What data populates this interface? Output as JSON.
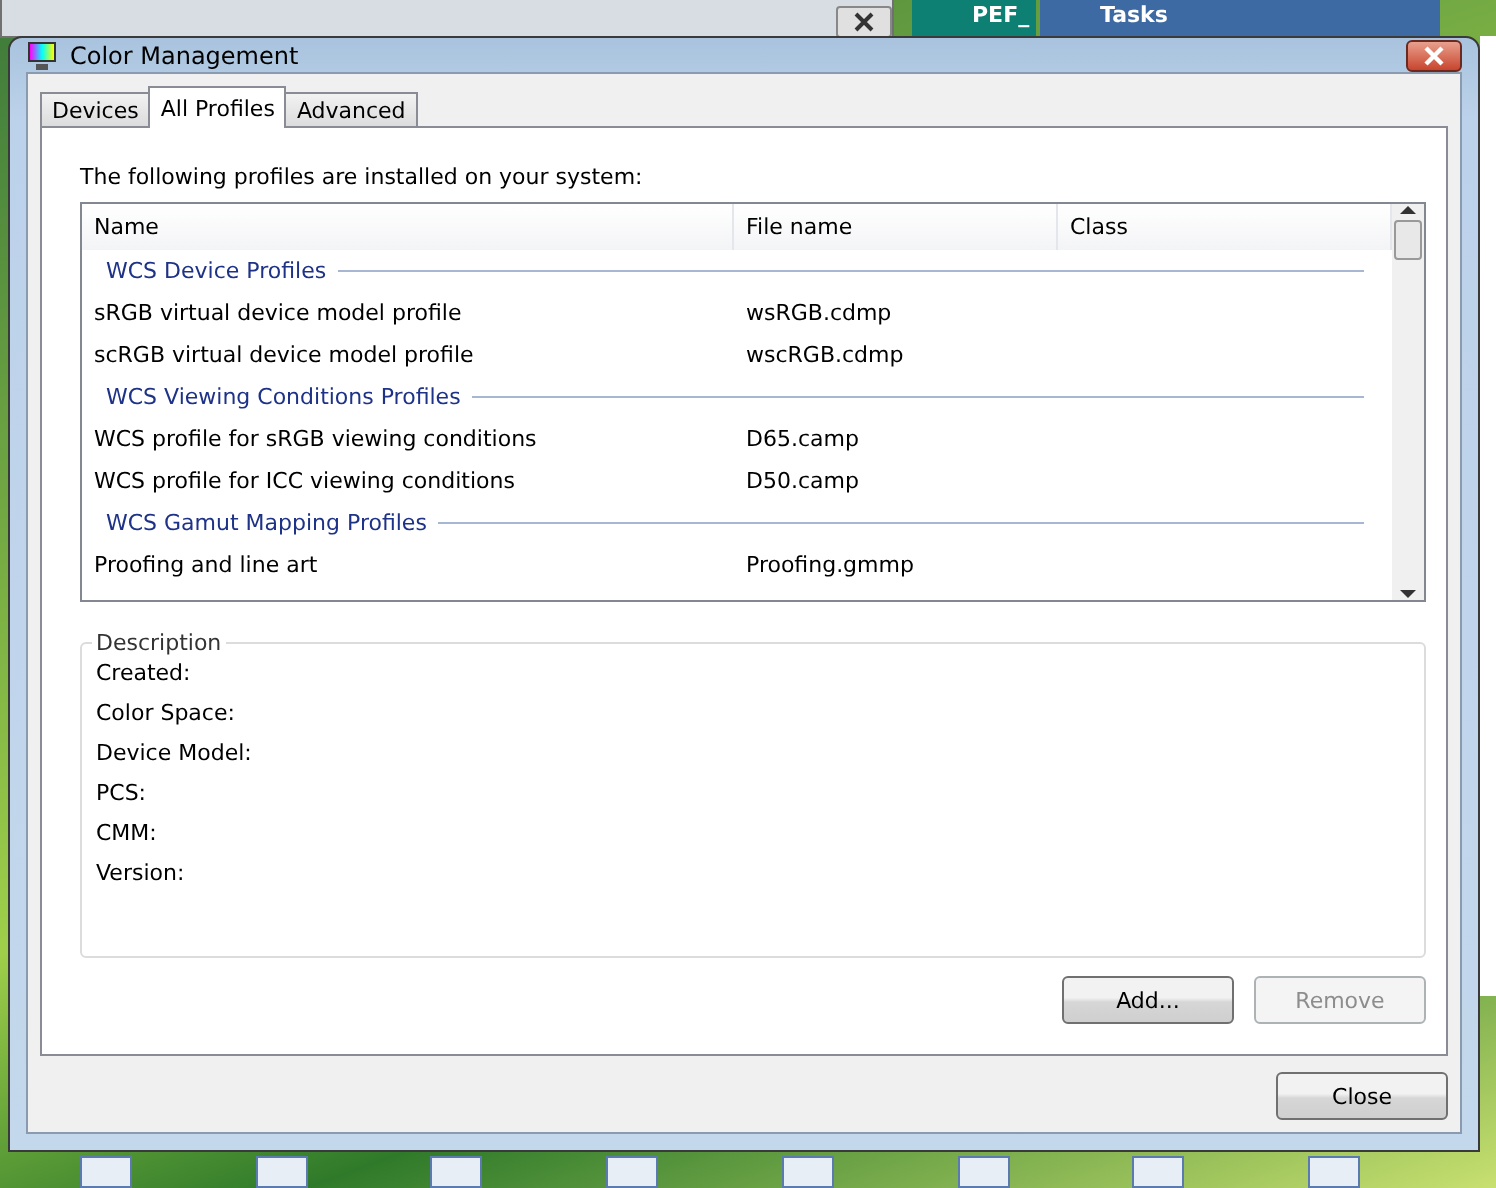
{
  "background_windows": [
    {
      "kind": "teal",
      "title": "PEF_"
    },
    {
      "kind": "tasks",
      "title": "Tasks"
    }
  ],
  "window": {
    "title": "Color Management"
  },
  "tabs": [
    {
      "label": "Devices",
      "selected": false
    },
    {
      "label": "All Profiles",
      "selected": true
    },
    {
      "label": "Advanced",
      "selected": false
    }
  ],
  "intro": "The following profiles are installed on your system:",
  "table": {
    "columns": [
      "Name",
      "File name",
      "Class"
    ],
    "rows": [
      {
        "kind": "group",
        "name": "WCS Device Profiles"
      },
      {
        "kind": "item",
        "name": "sRGB virtual device model profile",
        "file": "wsRGB.cdmp"
      },
      {
        "kind": "item",
        "name": "scRGB virtual device model profile",
        "file": "wscRGB.cdmp"
      },
      {
        "kind": "group",
        "name": "WCS Viewing Conditions Profiles"
      },
      {
        "kind": "item",
        "name": "WCS profile for sRGB viewing conditions",
        "file": "D65.camp"
      },
      {
        "kind": "item",
        "name": "WCS profile for ICC viewing conditions",
        "file": "D50.camp"
      },
      {
        "kind": "group",
        "name": "WCS Gamut Mapping Profiles"
      },
      {
        "kind": "item",
        "name": "Proofing and line art",
        "file": "Proofing.gmmp"
      }
    ]
  },
  "description": {
    "title": "Description",
    "fields": [
      "Created:",
      "Color Space:",
      "Device Model:",
      "PCS:",
      "CMM:",
      "Version:"
    ]
  },
  "buttons": [
    {
      "label": "Add...",
      "disabled": false
    },
    {
      "label": "Remove",
      "disabled": true
    }
  ],
  "close_button": "Close"
}
